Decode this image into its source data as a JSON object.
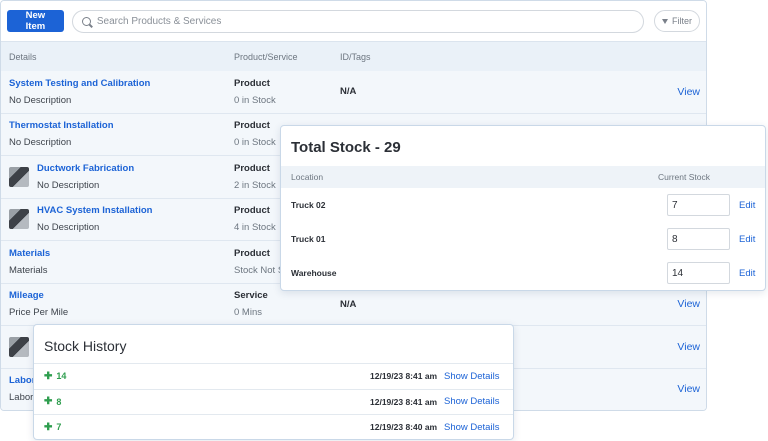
{
  "toolbar": {
    "new_item_label": "New Item",
    "search_placeholder": "Search Products & Services",
    "filter_label": "Filter"
  },
  "table": {
    "headers": [
      "Details",
      "Product/Service",
      "ID/Tags"
    ],
    "rows": [
      {
        "name": "System Testing and Calibration",
        "desc": "No Description",
        "type": "Product",
        "stock": "0 in Stock",
        "tags": "N/A",
        "action": "View"
      },
      {
        "name": "Thermostat Installation",
        "desc": "No Description",
        "type": "Product",
        "stock": "0 in Stock",
        "tags": "",
        "action": ""
      },
      {
        "name": "Ductwork Fabrication",
        "desc": "No Description",
        "type": "Product",
        "stock": "2 in Stock",
        "tags": "",
        "action": ""
      },
      {
        "name": "HVAC System Installation",
        "desc": "No Description",
        "type": "Product",
        "stock": "4 in Stock",
        "tags": "",
        "action": ""
      },
      {
        "name": "Materials",
        "desc": "Materials",
        "type": "Product",
        "stock": "Stock Not S",
        "tags": "",
        "action": ""
      },
      {
        "name": "Mileage",
        "desc": "Price Per Mile",
        "type": "Service",
        "stock": "0 Mins",
        "tags": "N/A",
        "action": "View"
      },
      {
        "name": "",
        "desc": "",
        "type": "",
        "stock": "",
        "tags": "",
        "action": "View"
      },
      {
        "name": "Labor",
        "desc": "Labor",
        "type": "",
        "stock": "",
        "tags": "",
        "action": "View"
      }
    ]
  },
  "total_stock": {
    "title": "Total Stock - 29",
    "col_location": "Location",
    "col_current": "Current Stock",
    "edit_label": "Edit",
    "rows": [
      {
        "location": "Truck 02",
        "stock": "7"
      },
      {
        "location": "Truck 01",
        "stock": "8"
      },
      {
        "location": "Warehouse",
        "stock": "14"
      }
    ]
  },
  "stock_history": {
    "title": "Stock History",
    "details_label": "Show Details",
    "rows": [
      {
        "qty": "14",
        "time": "12/19/23 8:41 am"
      },
      {
        "qty": "8",
        "time": "12/19/23 8:41 am"
      },
      {
        "qty": "7",
        "time": "12/19/23 8:40 am"
      }
    ]
  }
}
